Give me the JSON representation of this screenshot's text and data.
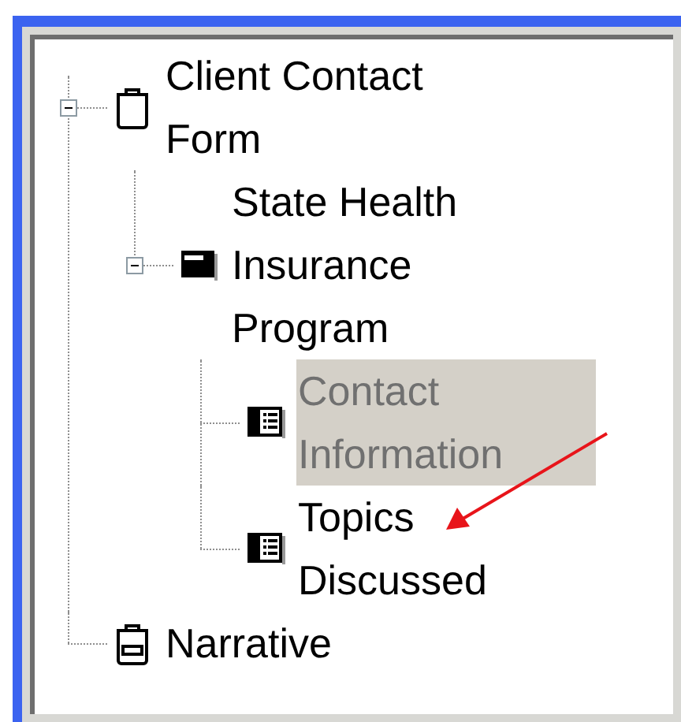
{
  "tree": [
    {
      "label": "Client Contact Form",
      "kind": "form",
      "selected": false,
      "expanded": true,
      "children": [
        {
          "label": "State Health Insurance Program",
          "kind": "section",
          "selected": false,
          "expanded": true,
          "children": [
            {
              "label": "Contact Information",
              "kind": "page",
              "selected": true
            },
            {
              "label": "Topics Discussed",
              "kind": "page",
              "selected": false
            }
          ]
        }
      ]
    },
    {
      "label": "Narrative",
      "kind": "narrative",
      "selected": false
    }
  ]
}
